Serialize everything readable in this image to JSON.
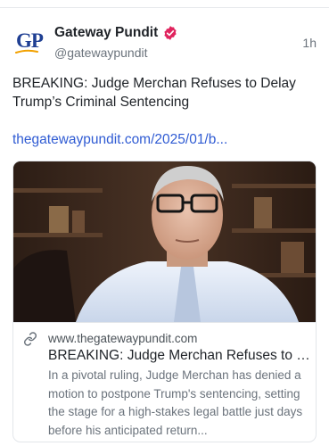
{
  "post": {
    "author_name": "Gateway Pundit",
    "handle": "@gatewaypundit",
    "timestamp": "1h",
    "avatar_initials": "GP",
    "text": "BREAKING: Judge Merchan Refuses to Delay Trump’s Criminal Sentencing",
    "link": "thegatewaypundit.com/2025/01/b..."
  },
  "link_card": {
    "domain": "www.thegatewaypundit.com",
    "title": "BREAKING: Judge Merchan Refuses to Delay Trump’s Criminal Sentencing",
    "description": "In a pivotal ruling, Judge Merchan has denied a motion to postpone Trump's sentencing, setting the stage for a high-stakes legal battle just days before his anticipated return..."
  },
  "colors": {
    "link": "#2f5bd3",
    "verified_badge": "#e0245e",
    "avatar_text": "#1f3f93",
    "avatar_swoosh": "#f2a100"
  },
  "icons": {
    "verified": "verified-badge-icon",
    "link": "link-chain-icon"
  }
}
